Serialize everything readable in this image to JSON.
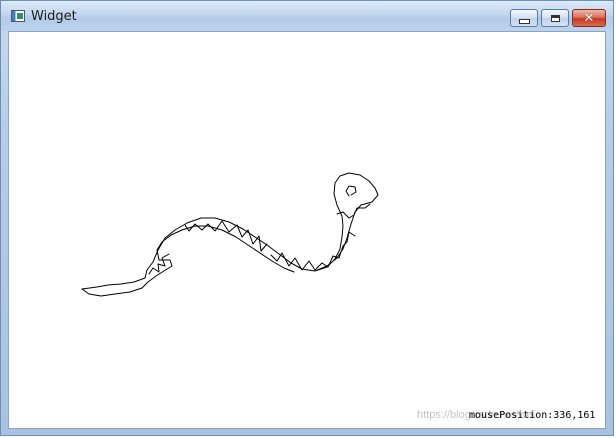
{
  "window": {
    "title": "Widget",
    "icon": "app-window-icon",
    "controls": {
      "minimize_icon": "minimize-icon",
      "maximize_icon": "maximize-icon",
      "close_icon": "close-icon",
      "close_glyph": "✕"
    }
  },
  "canvas": {
    "background": "#ffffff",
    "stroke_color": "#000000",
    "mouse_position_text": "mousePosition:336,161",
    "watermark": "https://blog.csdn.net/wei"
  }
}
